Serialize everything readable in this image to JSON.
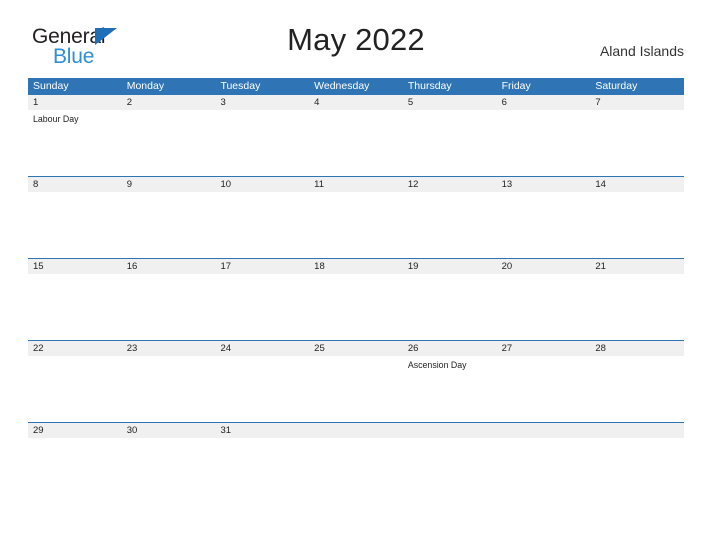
{
  "brand": {
    "name_top": "General",
    "name_bottom": "Blue",
    "top_color": "#231f20",
    "bottom_color": "#2f8fd6",
    "triangle_color": "#1f6fb8"
  },
  "header": {
    "title": "May 2022",
    "location": "Aland Islands"
  },
  "theme": {
    "header_bg": "#2f74b5",
    "header_text": "#ffffff",
    "date_band_bg": "#f0f0f0",
    "grid_line": "#2f74b5",
    "body_bg": "#ffffff",
    "text": "#222222"
  },
  "calendar": {
    "weekdays": [
      "Sunday",
      "Monday",
      "Tuesday",
      "Wednesday",
      "Thursday",
      "Friday",
      "Saturday"
    ],
    "weeks": [
      {
        "days": [
          {
            "date": "1",
            "events": [
              "Labour Day"
            ]
          },
          {
            "date": "2",
            "events": []
          },
          {
            "date": "3",
            "events": []
          },
          {
            "date": "4",
            "events": []
          },
          {
            "date": "5",
            "events": []
          },
          {
            "date": "6",
            "events": []
          },
          {
            "date": "7",
            "events": []
          }
        ]
      },
      {
        "days": [
          {
            "date": "8",
            "events": []
          },
          {
            "date": "9",
            "events": []
          },
          {
            "date": "10",
            "events": []
          },
          {
            "date": "11",
            "events": []
          },
          {
            "date": "12",
            "events": []
          },
          {
            "date": "13",
            "events": []
          },
          {
            "date": "14",
            "events": []
          }
        ]
      },
      {
        "days": [
          {
            "date": "15",
            "events": []
          },
          {
            "date": "16",
            "events": []
          },
          {
            "date": "17",
            "events": []
          },
          {
            "date": "18",
            "events": []
          },
          {
            "date": "19",
            "events": []
          },
          {
            "date": "20",
            "events": []
          },
          {
            "date": "21",
            "events": []
          }
        ]
      },
      {
        "days": [
          {
            "date": "22",
            "events": []
          },
          {
            "date": "23",
            "events": []
          },
          {
            "date": "24",
            "events": []
          },
          {
            "date": "25",
            "events": []
          },
          {
            "date": "26",
            "events": [
              "Ascension Day"
            ]
          },
          {
            "date": "27",
            "events": []
          },
          {
            "date": "28",
            "events": []
          }
        ]
      },
      {
        "days": [
          {
            "date": "29",
            "events": []
          },
          {
            "date": "30",
            "events": []
          },
          {
            "date": "31",
            "events": []
          },
          {
            "date": "",
            "events": []
          },
          {
            "date": "",
            "events": []
          },
          {
            "date": "",
            "events": []
          },
          {
            "date": "",
            "events": []
          }
        ]
      }
    ]
  }
}
